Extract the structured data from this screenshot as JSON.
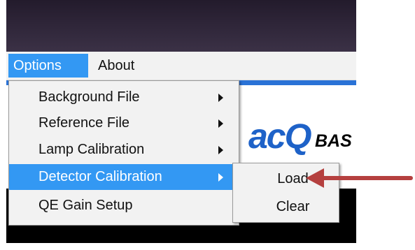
{
  "menubar": {
    "items": [
      {
        "label": "Options"
      },
      {
        "label": "About"
      }
    ]
  },
  "options_menu": {
    "items": [
      {
        "label": "Background File",
        "has_submenu": true
      },
      {
        "label": "Reference File",
        "has_submenu": true
      },
      {
        "label": "Lamp Calibration",
        "has_submenu": true
      },
      {
        "label": "Detector Calibration",
        "has_submenu": true,
        "highlighted": true
      },
      {
        "label": "QE Gain Setup",
        "has_submenu": false
      }
    ]
  },
  "detector_submenu": {
    "items": [
      {
        "label": "Load"
      },
      {
        "label": "Clear"
      }
    ]
  },
  "logo": {
    "mark": "acQ",
    "suffix": "BAS"
  },
  "colors": {
    "highlight": "#3398f3",
    "annotation_arrow": "#b5403f",
    "titlebar": "#2e2538"
  }
}
